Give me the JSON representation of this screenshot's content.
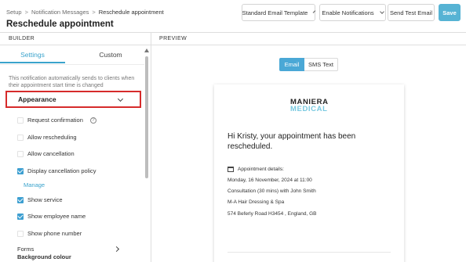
{
  "breadcrumb": {
    "items": [
      "Setup",
      "Notification Messages",
      "Reschedule appointment"
    ],
    "separator": ">"
  },
  "page_title": "Reschedule appointment",
  "toolbar": {
    "template_label": "Standard Email Template",
    "notifications_label": "Enable Notifications",
    "test_label": "Send Test Email",
    "save_label": "Save"
  },
  "builder": {
    "section_label": "BUILDER",
    "tabs": [
      {
        "label": "Settings",
        "active": true
      },
      {
        "label": "Custom",
        "active": false
      }
    ],
    "info_text": "This notification automatically sends to clients when their appointment start time is changed",
    "appearance_label": "Appearance",
    "options": [
      {
        "label": "Request confirmation",
        "checked": false,
        "help": "?"
      },
      {
        "label": "Allow rescheduling",
        "checked": false
      },
      {
        "label": "Allow cancellation",
        "checked": false
      },
      {
        "label": "Display cancellation policy",
        "checked": true
      },
      {
        "label": "Show service",
        "checked": true
      },
      {
        "label": "Show employee name",
        "checked": true
      },
      {
        "label": "Show phone number",
        "checked": false
      }
    ],
    "manage_link": "Manage",
    "forms_label": "Forms",
    "background_label": "Background colour"
  },
  "preview": {
    "section_label": "PREVIEW",
    "modes": [
      {
        "label": "Email",
        "active": true
      },
      {
        "label": "SMS Text",
        "active": false
      }
    ],
    "email": {
      "logo_top": "MANIERA",
      "logo_bottom": "MEDICAL",
      "greeting": "Hi Kristy, your appointment has been rescheduled.",
      "details_label": "Appointment details:",
      "date_line": "Monday, 16 November, 2024 at 11:00",
      "service_line": "Consultation (30 mins) with John Smith",
      "location_name": "M-A Hair Dressing & Spa",
      "address": "574 Beferly Road H3454 , England, GB"
    }
  },
  "colors": {
    "accent": "#3aa3cc",
    "save": "#56b3d4",
    "highlight_border": "#d62b2b",
    "logo_accent": "#78c9e0"
  }
}
